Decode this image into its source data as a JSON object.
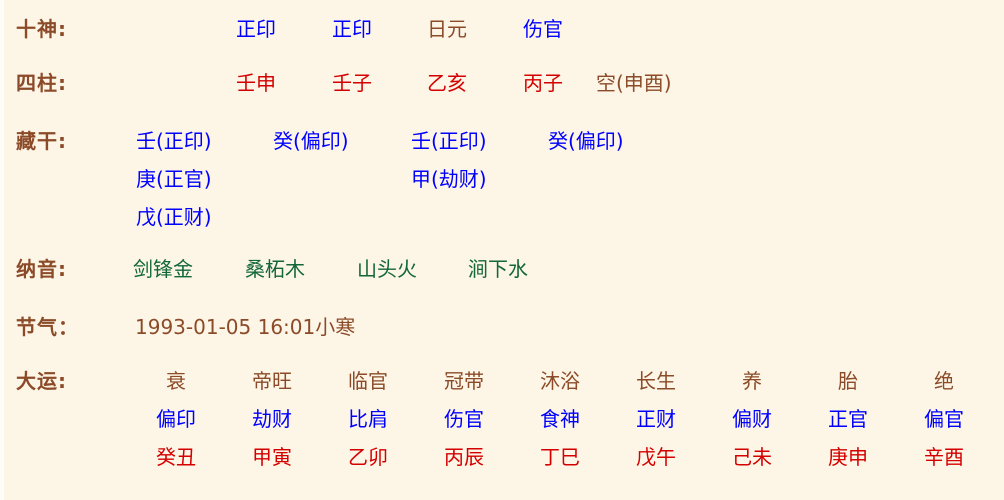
{
  "theme": {
    "background": "#fdf5e6",
    "label_color": "#8b4b28",
    "blue": "#0000ff",
    "red": "#d40000",
    "green": "#11663a",
    "brown": "#8b4b28"
  },
  "rows": {
    "shishen": {
      "label": "十神:",
      "values": [
        "正印",
        "正印",
        "日元",
        "伤官"
      ]
    },
    "sizhu": {
      "label": "四柱:",
      "values": [
        "壬申",
        "壬子",
        "乙亥",
        "丙子"
      ],
      "kong": "空(申酉)"
    },
    "canggan": {
      "label": "藏干:",
      "lines": [
        [
          "壬(正印)",
          "癸(偏印)",
          "壬(正印)",
          "癸(偏印)"
        ],
        [
          "庚(正官)",
          "",
          "甲(劫财)",
          ""
        ],
        [
          "戊(正财)",
          "",
          "",
          ""
        ]
      ]
    },
    "nayin": {
      "label": "纳音:",
      "values": [
        "剑锋金",
        "桑柘木",
        "山头火",
        "涧下水"
      ]
    },
    "jieqi": {
      "label": "节气：",
      "value": "1993-01-05 16:01小寒"
    },
    "dayun": {
      "label": "大运:",
      "stages": [
        "衰",
        "帝旺",
        "临官",
        "冠带",
        "沐浴",
        "长生",
        "养",
        "胎",
        "绝"
      ],
      "tenGods": [
        "偏印",
        "劫财",
        "比肩",
        "伤官",
        "食神",
        "正财",
        "偏财",
        "正官",
        "偏官"
      ],
      "pillars": [
        "癸丑",
        "甲寅",
        "乙卯",
        "丙辰",
        "丁巳",
        "戊午",
        "己未",
        "庚申",
        "辛酉"
      ]
    }
  }
}
